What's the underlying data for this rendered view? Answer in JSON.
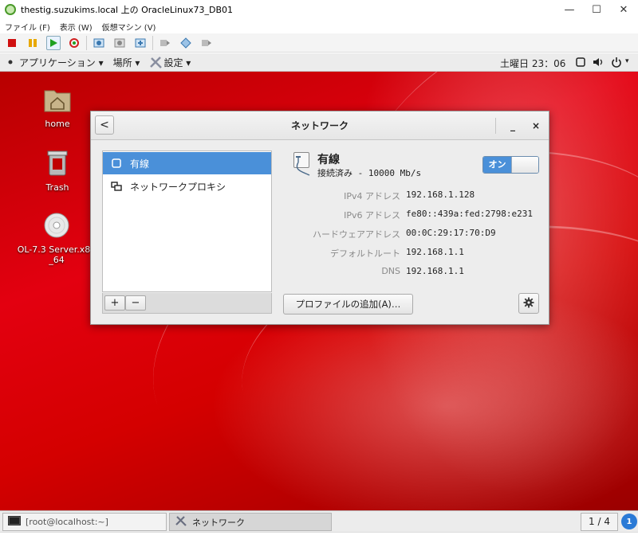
{
  "host_window": {
    "title": "thestig.suzukims.local 上の OracleLinux73_DB01",
    "controls": {
      "minimize": "—",
      "maximize": "☐",
      "close": "✕"
    },
    "menu": [
      "ファイル (F)",
      "表示 (W)",
      "仮想マシン (V)"
    ]
  },
  "gnome_top_bar": {
    "applications": "アプリケーション ▾",
    "places": "場所 ▾",
    "settings": "設定 ▾",
    "clock": "土曜日 23：06"
  },
  "desktop_icons": [
    {
      "label": "home"
    },
    {
      "label": "Trash"
    },
    {
      "label": "OL-7.3 Server.x86_64"
    }
  ],
  "dialog": {
    "title": "ネットワーク",
    "back": "<",
    "minimize": "_",
    "close": "×",
    "connections": [
      {
        "label": "有線"
      },
      {
        "label": "ネットワークプロキシ"
      }
    ],
    "add_button": "+",
    "remove_button": "−",
    "detail": {
      "name": "有線",
      "status": "接続済み - 10000 Mb/s",
      "toggle_label": "オン",
      "rows": [
        {
          "label": "IPv4 アドレス",
          "value": "192.168.1.128"
        },
        {
          "label": "IPv6 アドレス",
          "value": "fe80::439a:fed:2798:e231"
        },
        {
          "label": "ハードウェアアドレス",
          "value": "00:0C:29:17:70:D9"
        },
        {
          "label": "デフォルトルート",
          "value": "192.168.1.1"
        },
        {
          "label": "DNS",
          "value": "192.168.1.1"
        }
      ],
      "add_profile": "プロファイルの追加(A)…"
    }
  },
  "gnome_bottom_bar": {
    "tasks": [
      "[root@localhost:~]",
      "ネットワーク"
    ],
    "workspace": "1 / 4"
  },
  "colors": {
    "selection": "#4a90d9",
    "desktop_red": "#d40000"
  }
}
